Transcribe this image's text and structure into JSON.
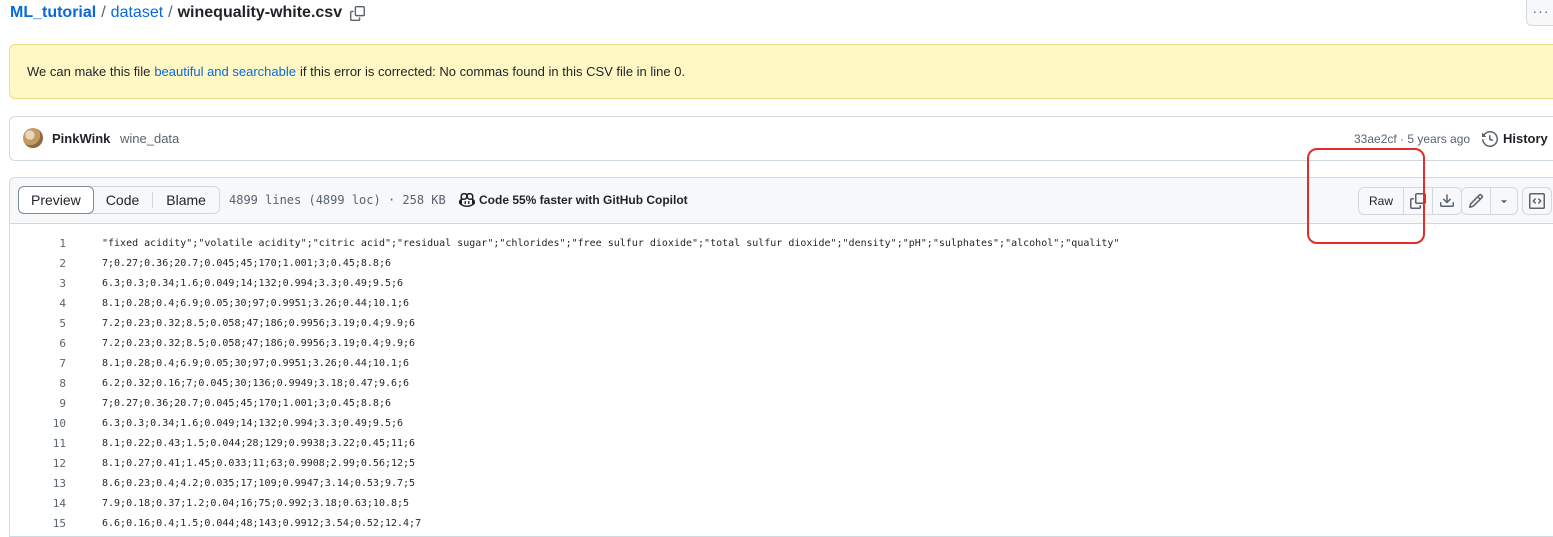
{
  "breadcrumb": {
    "repo": "ML_tutorial",
    "folder": "dataset",
    "file": "winequality-white.csv",
    "separator": "/"
  },
  "more_label": "···",
  "banner": {
    "prefix": "We can make this file",
    "link": "beautiful and searchable",
    "suffix": "if this error is corrected: No commas found in this CSV file in line 0."
  },
  "commit": {
    "author": "PinkWink",
    "message": "wine_data",
    "meta": "33ae2cf · 5 years ago",
    "history_label": "History"
  },
  "file_header": {
    "tabs": [
      "Preview",
      "Code",
      "Blame"
    ],
    "active_tab": "Preview",
    "info": "4899 lines (4899 loc) · 258 KB",
    "copilot": "Code 55% faster with GitHub Copilot",
    "raw_label": "Raw"
  },
  "code_lines": [
    {
      "n": "1",
      "t": "\"fixed acidity\";\"volatile acidity\";\"citric acid\";\"residual sugar\";\"chlorides\";\"free sulfur dioxide\";\"total sulfur dioxide\";\"density\";\"pH\";\"sulphates\";\"alcohol\";\"quality\""
    },
    {
      "n": "2",
      "t": "7;0.27;0.36;20.7;0.045;45;170;1.001;3;0.45;8.8;6"
    },
    {
      "n": "3",
      "t": "6.3;0.3;0.34;1.6;0.049;14;132;0.994;3.3;0.49;9.5;6"
    },
    {
      "n": "4",
      "t": "8.1;0.28;0.4;6.9;0.05;30;97;0.9951;3.26;0.44;10.1;6"
    },
    {
      "n": "5",
      "t": "7.2;0.23;0.32;8.5;0.058;47;186;0.9956;3.19;0.4;9.9;6"
    },
    {
      "n": "6",
      "t": "7.2;0.23;0.32;8.5;0.058;47;186;0.9956;3.19;0.4;9.9;6"
    },
    {
      "n": "7",
      "t": "8.1;0.28;0.4;6.9;0.05;30;97;0.9951;3.26;0.44;10.1;6"
    },
    {
      "n": "8",
      "t": "6.2;0.32;0.16;7;0.045;30;136;0.9949;3.18;0.47;9.6;6"
    },
    {
      "n": "9",
      "t": "7;0.27;0.36;20.7;0.045;45;170;1.001;3;0.45;8.8;6"
    },
    {
      "n": "10",
      "t": "6.3;0.3;0.34;1.6;0.049;14;132;0.994;3.3;0.49;9.5;6"
    },
    {
      "n": "11",
      "t": "8.1;0.22;0.43;1.5;0.044;28;129;0.9938;3.22;0.45;11;6"
    },
    {
      "n": "12",
      "t": "8.1;0.27;0.41;1.45;0.033;11;63;0.9908;2.99;0.56;12;5"
    },
    {
      "n": "13",
      "t": "8.6;0.23;0.4;4.2;0.035;17;109;0.9947;3.14;0.53;9.7;5"
    },
    {
      "n": "14",
      "t": "7.9;0.18;0.37;1.2;0.04;16;75;0.992;3.18;0.63;10.8;5"
    },
    {
      "n": "15",
      "t": "6.6;0.16;0.4;1.5;0.044;48;143;0.9912;3.54;0.52;12.4;7"
    }
  ],
  "colors": {
    "link": "#0969da",
    "banner_bg": "#fff8c5",
    "annotation": "#e22b2b"
  }
}
